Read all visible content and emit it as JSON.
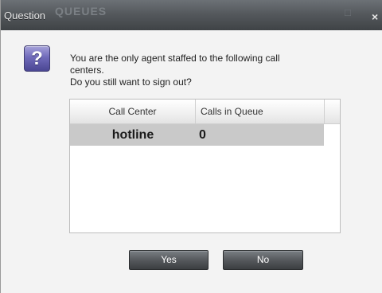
{
  "dialog": {
    "title": "Question",
    "background_watermark": "QUEUES",
    "close_glyph": "×"
  },
  "icon": {
    "name": "question-icon",
    "glyph": "?"
  },
  "message": {
    "line1": "You are the only agent staffed to the following call",
    "line2": "centers.",
    "line3": "Do you still want to sign out?"
  },
  "table": {
    "columns": [
      "Call Center",
      "Calls in Queue"
    ],
    "rows": [
      {
        "call_center": "hotline",
        "calls_in_queue": "0"
      }
    ]
  },
  "buttons": {
    "yes": "Yes",
    "no": "No"
  },
  "colors": {
    "titlebar": "#55595d",
    "row_selected": "#c9c9c9",
    "button": "#56595d",
    "icon_accent": "#6f6aba"
  }
}
